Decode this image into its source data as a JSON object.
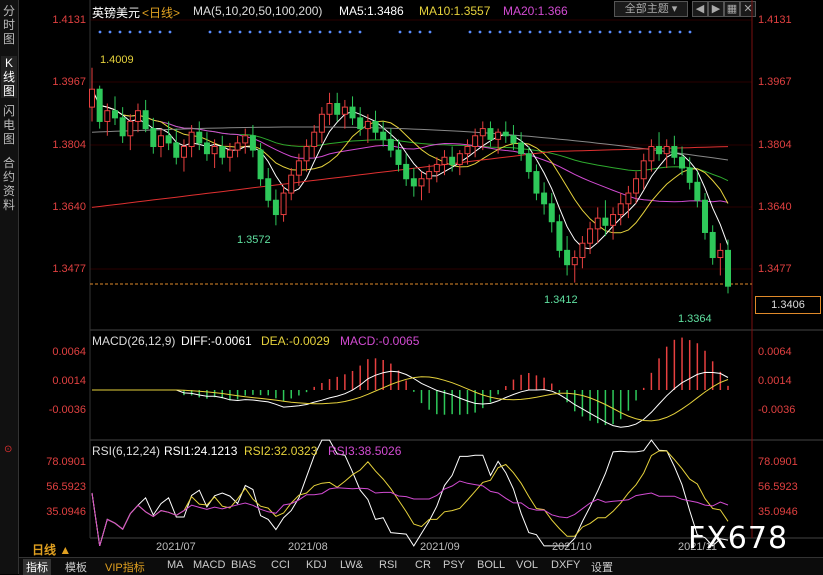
{
  "sidebar": {
    "tabs": [
      {
        "label": "分时图",
        "active": false
      },
      {
        "label": "K线图",
        "active": true
      },
      {
        "label": "闪电图",
        "active": false
      },
      {
        "label": "合约资料",
        "active": false
      }
    ]
  },
  "header": {
    "instrument": "英镑美元",
    "period": "<日线>",
    "ma_params": "MA(5,10,20,50,100,200)",
    "ma5": "MA5:1.3486",
    "ma10": "MA10:1.3557",
    "ma20": "MA20:1.366",
    "theme_select": "全部主题",
    "colors": {
      "ma5": "#ffffff",
      "ma10": "#e6d23c",
      "ma20": "#d24bd2",
      "ma50": "#2eaa2e",
      "ma100": "#888888",
      "ma200": "#e03030",
      "up": "#e84040",
      "down": "#2ec85a"
    }
  },
  "price_axis": {
    "ticks": [
      "1.4131",
      "1.3967",
      "1.3804",
      "1.3640",
      "1.3477"
    ],
    "current_price": "1.3406"
  },
  "annotations": {
    "high": "1.4009",
    "low1": "1.3572",
    "low2": "1.3412",
    "low3": "1.3364"
  },
  "macd": {
    "title": "MACD(26,12,9)",
    "diff": "DIFF:-0.0061",
    "dea": "DEA:-0.0029",
    "macd": "MACD:-0.0065",
    "ticks": [
      "0.0064",
      "0.0014",
      "-0.0036"
    ]
  },
  "rsi": {
    "title": "RSI(6,12,24)",
    "rsi1": "RSI1:24.1213",
    "rsi2": "RSI2:32.0323",
    "rsi3": "RSI3:38.5026",
    "ticks": [
      "78.0901",
      "56.5923",
      "35.0946"
    ]
  },
  "dates": [
    "2021/07",
    "2021/08",
    "2021/09",
    "2021/10",
    "2021/11"
  ],
  "period_label": "日线",
  "toolbar": [
    "指标",
    "模板",
    "VIP指标",
    "MA",
    "MACD",
    "BIAS",
    "CCI",
    "KDJ",
    "LW&",
    "RSI",
    "CR",
    "PSY",
    "BOLL",
    "VOL",
    "DXFY",
    "设置"
  ],
  "watermark": "FX678",
  "chart_data": {
    "type": "candlestick",
    "y_range": [
      1.33,
      1.416
    ],
    "ohlc": [
      [
        1.39,
        1.401,
        1.386,
        1.395
      ],
      [
        1.395,
        1.396,
        1.384,
        1.386
      ],
      [
        1.386,
        1.391,
        1.382,
        1.389
      ],
      [
        1.389,
        1.393,
        1.385,
        1.387
      ],
      [
        1.387,
        1.39,
        1.38,
        1.382
      ],
      [
        1.382,
        1.388,
        1.378,
        1.386
      ],
      [
        1.386,
        1.391,
        1.383,
        1.389
      ],
      [
        1.389,
        1.392,
        1.383,
        1.384
      ],
      [
        1.384,
        1.387,
        1.377,
        1.379
      ],
      [
        1.379,
        1.384,
        1.376,
        1.382
      ],
      [
        1.382,
        1.386,
        1.378,
        1.38
      ],
      [
        1.38,
        1.384,
        1.374,
        1.376
      ],
      [
        1.376,
        1.381,
        1.372,
        1.379
      ],
      [
        1.379,
        1.385,
        1.376,
        1.383
      ],
      [
        1.383,
        1.386,
        1.378,
        1.38
      ],
      [
        1.38,
        1.383,
        1.375,
        1.377
      ],
      [
        1.377,
        1.381,
        1.373,
        1.379
      ],
      [
        1.379,
        1.382,
        1.374,
        1.376
      ],
      [
        1.376,
        1.38,
        1.372,
        1.378
      ],
      [
        1.378,
        1.382,
        1.376,
        1.38
      ],
      [
        1.38,
        1.384,
        1.377,
        1.382
      ],
      [
        1.382,
        1.385,
        1.376,
        1.378
      ],
      [
        1.378,
        1.38,
        1.368,
        1.37
      ],
      [
        1.37,
        1.373,
        1.362,
        1.364
      ],
      [
        1.364,
        1.367,
        1.357,
        1.36
      ],
      [
        1.36,
        1.368,
        1.358,
        1.366
      ],
      [
        1.366,
        1.373,
        1.364,
        1.371
      ],
      [
        1.371,
        1.377,
        1.368,
        1.375
      ],
      [
        1.375,
        1.381,
        1.372,
        1.379
      ],
      [
        1.379,
        1.385,
        1.376,
        1.383
      ],
      [
        1.383,
        1.39,
        1.38,
        1.388
      ],
      [
        1.388,
        1.394,
        1.385,
        1.391
      ],
      [
        1.391,
        1.394,
        1.386,
        1.388
      ],
      [
        1.388,
        1.392,
        1.384,
        1.39
      ],
      [
        1.39,
        1.393,
        1.385,
        1.387
      ],
      [
        1.387,
        1.39,
        1.382,
        1.384
      ],
      [
        1.384,
        1.388,
        1.38,
        1.386
      ],
      [
        1.386,
        1.389,
        1.381,
        1.383
      ],
      [
        1.383,
        1.386,
        1.379,
        1.381
      ],
      [
        1.381,
        1.384,
        1.376,
        1.378
      ],
      [
        1.378,
        1.381,
        1.372,
        1.374
      ],
      [
        1.374,
        1.377,
        1.368,
        1.37
      ],
      [
        1.37,
        1.373,
        1.365,
        1.368
      ],
      [
        1.368,
        1.372,
        1.364,
        1.37
      ],
      [
        1.37,
        1.374,
        1.366,
        1.372
      ],
      [
        1.372,
        1.376,
        1.369,
        1.374
      ],
      [
        1.374,
        1.378,
        1.371,
        1.376
      ],
      [
        1.376,
        1.379,
        1.372,
        1.374
      ],
      [
        1.374,
        1.378,
        1.371,
        1.377
      ],
      [
        1.377,
        1.381,
        1.374,
        1.379
      ],
      [
        1.379,
        1.384,
        1.376,
        1.382
      ],
      [
        1.382,
        1.386,
        1.378,
        1.384
      ],
      [
        1.384,
        1.386,
        1.379,
        1.381
      ],
      [
        1.381,
        1.384,
        1.377,
        1.383
      ],
      [
        1.383,
        1.386,
        1.38,
        1.382
      ],
      [
        1.382,
        1.385,
        1.378,
        1.38
      ],
      [
        1.38,
        1.383,
        1.375,
        1.377
      ],
      [
        1.377,
        1.379,
        1.37,
        1.372
      ],
      [
        1.372,
        1.374,
        1.364,
        1.366
      ],
      [
        1.366,
        1.369,
        1.36,
        1.363
      ],
      [
        1.363,
        1.366,
        1.355,
        1.358
      ],
      [
        1.358,
        1.36,
        1.348,
        1.35
      ],
      [
        1.35,
        1.354,
        1.343,
        1.346
      ],
      [
        1.346,
        1.35,
        1.341,
        1.348
      ],
      [
        1.348,
        1.354,
        1.345,
        1.352
      ],
      [
        1.352,
        1.358,
        1.349,
        1.356
      ],
      [
        1.356,
        1.362,
        1.352,
        1.359
      ],
      [
        1.359,
        1.364,
        1.354,
        1.357
      ],
      [
        1.357,
        1.362,
        1.353,
        1.36
      ],
      [
        1.36,
        1.366,
        1.357,
        1.363
      ],
      [
        1.363,
        1.368,
        1.359,
        1.366
      ],
      [
        1.366,
        1.372,
        1.363,
        1.37
      ],
      [
        1.37,
        1.377,
        1.367,
        1.375
      ],
      [
        1.375,
        1.381,
        1.372,
        1.379
      ],
      [
        1.379,
        1.383,
        1.375,
        1.377
      ],
      [
        1.377,
        1.381,
        1.373,
        1.379
      ],
      [
        1.379,
        1.382,
        1.374,
        1.376
      ],
      [
        1.376,
        1.379,
        1.371,
        1.373
      ],
      [
        1.373,
        1.376,
        1.367,
        1.369
      ],
      [
        1.369,
        1.372,
        1.362,
        1.364
      ],
      [
        1.364,
        1.366,
        1.353,
        1.355
      ],
      [
        1.355,
        1.357,
        1.346,
        1.348
      ],
      [
        1.348,
        1.352,
        1.343,
        1.35
      ],
      [
        1.35,
        1.353,
        1.338,
        1.34
      ]
    ]
  }
}
